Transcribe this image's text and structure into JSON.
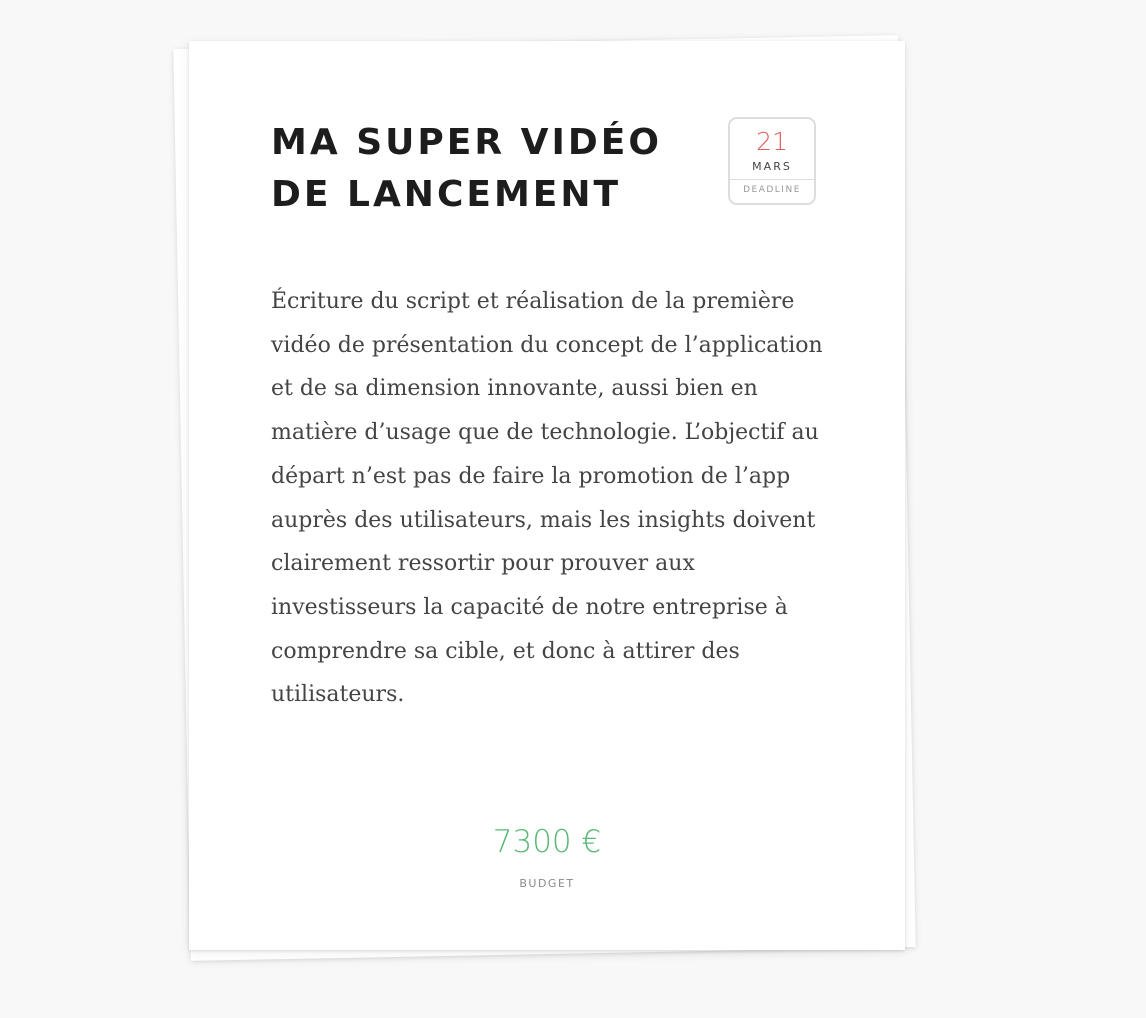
{
  "card": {
    "title": "MA SUPER VIDÉO\nDE LANCEMENT",
    "deadline": {
      "day": "21",
      "month": "MARS",
      "label": "DEADLINE"
    },
    "description": "Écriture du script et réalisation de la première vidéo de présentation du concept de l’application et de sa dimension innovante, aussi bien en matière d’usage que de technologie. L’objectif au départ n’est pas de faire la promotion de l’app auprès des utilisateurs, mais les insights doivent clairement ressortir pour prouver aux investisseurs la capacité de notre entreprise à comprendre sa cible, et donc à attirer des utilisateurs.",
    "budget": {
      "value": "7300 €",
      "label": "BUDGET"
    }
  },
  "colors": {
    "deadline_day": "#e25c5c",
    "budget_value": "#5ab975",
    "title": "#1d1d1d",
    "body_text": "#444444",
    "background": "#f8f8f8"
  }
}
